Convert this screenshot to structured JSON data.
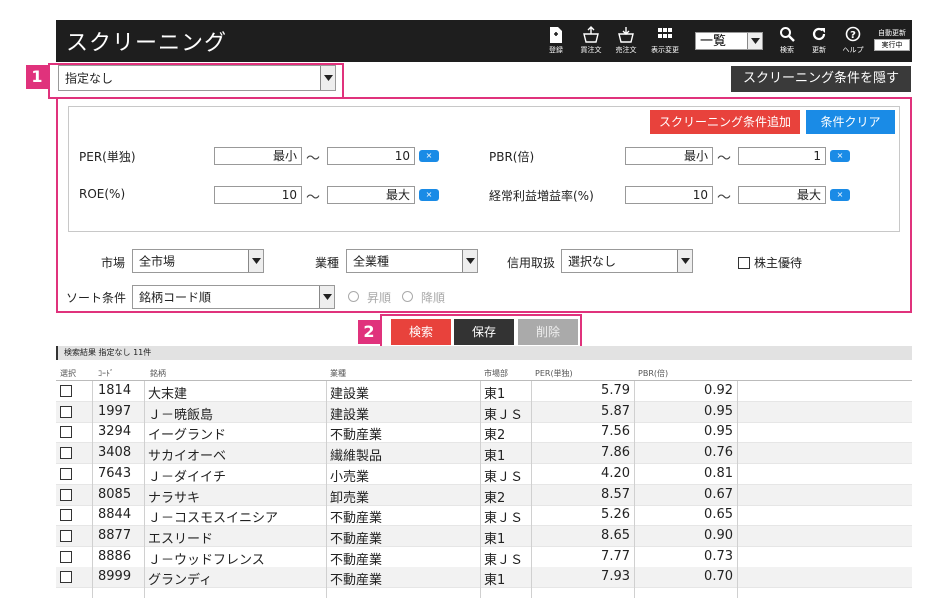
{
  "header": {
    "title": "スクリーニング",
    "tools": [
      {
        "icon": "register-icon",
        "label": "登録"
      },
      {
        "icon": "buy-order-icon",
        "label": "買注文"
      },
      {
        "icon": "sell-order-icon",
        "label": "売注文"
      },
      {
        "icon": "display-change-icon",
        "label": "表示変更"
      }
    ],
    "view_select": "一覧",
    "search_label": "検索",
    "refresh_label": "更新",
    "help_label": "ヘルプ",
    "auto_update_label": "自動更新",
    "auto_update_state": "実行中"
  },
  "callouts": {
    "one": "1",
    "two": "2"
  },
  "preset_select": "指定なし",
  "hide_conditions_label": "スクリーニング条件を隠す",
  "conditions": {
    "add_label": "スクリーニング条件追加",
    "clear_label": "条件クリア",
    "rows": [
      {
        "label": "PER(単独)",
        "min": "最小",
        "max": "10"
      },
      {
        "label": "PBR(倍)",
        "min": "最小",
        "max": "1"
      },
      {
        "label": "ROE(%)",
        "min": "10",
        "max": "最大"
      },
      {
        "label": "経常利益増益率(%)",
        "min": "10",
        "max": "最大"
      }
    ],
    "tilde": "〜",
    "x_label": "×"
  },
  "filters": {
    "market_label": "市場",
    "market_value": "全市場",
    "industry_label": "業種",
    "industry_value": "全業種",
    "margin_label": "信用取扱",
    "margin_value": "選択なし",
    "benefit_label": "株主優待",
    "sort_label": "ソート条件",
    "sort_value": "銘柄コード順",
    "asc_label": "昇順",
    "desc_label": "降順"
  },
  "actions": {
    "search": "検索",
    "save": "保存",
    "delete": "削除"
  },
  "results": {
    "summary": "検索結果 指定なし 11件",
    "columns": [
      "選択",
      "ｺｰﾄﾞ",
      "銘柄",
      "業種",
      "市場部",
      "PER(単独)",
      "PBR(倍)"
    ],
    "rows": [
      {
        "code": "1814",
        "name": "大末建",
        "industry": "建設業",
        "market": "東1",
        "per": "5.79",
        "pbr": "0.92"
      },
      {
        "code": "1997",
        "name": "Ｊ－暁飯島",
        "industry": "建設業",
        "market": "東ＪＳ",
        "per": "5.87",
        "pbr": "0.95"
      },
      {
        "code": "3294",
        "name": "イーグランド",
        "industry": "不動産業",
        "market": "東2",
        "per": "7.56",
        "pbr": "0.95"
      },
      {
        "code": "3408",
        "name": "サカイオーベ",
        "industry": "繊維製品",
        "market": "東1",
        "per": "7.86",
        "pbr": "0.76"
      },
      {
        "code": "7643",
        "name": "Ｊ－ダイイチ",
        "industry": "小売業",
        "market": "東ＪＳ",
        "per": "4.20",
        "pbr": "0.81"
      },
      {
        "code": "8085",
        "name": "ナラサキ",
        "industry": "卸売業",
        "market": "東2",
        "per": "8.57",
        "pbr": "0.67"
      },
      {
        "code": "8844",
        "name": "Ｊ－コスモスイニシア",
        "industry": "不動産業",
        "market": "東ＪＳ",
        "per": "5.26",
        "pbr": "0.65"
      },
      {
        "code": "8877",
        "name": "エスリード",
        "industry": "不動産業",
        "market": "東1",
        "per": "8.65",
        "pbr": "0.90"
      },
      {
        "code": "8886",
        "name": "Ｊ－ウッドフレンス",
        "industry": "不動産業",
        "market": "東ＪＳ",
        "per": "7.77",
        "pbr": "0.73"
      },
      {
        "code": "8999",
        "name": "グランディ",
        "industry": "不動産業",
        "market": "東1",
        "per": "7.93",
        "pbr": "0.70"
      }
    ]
  }
}
